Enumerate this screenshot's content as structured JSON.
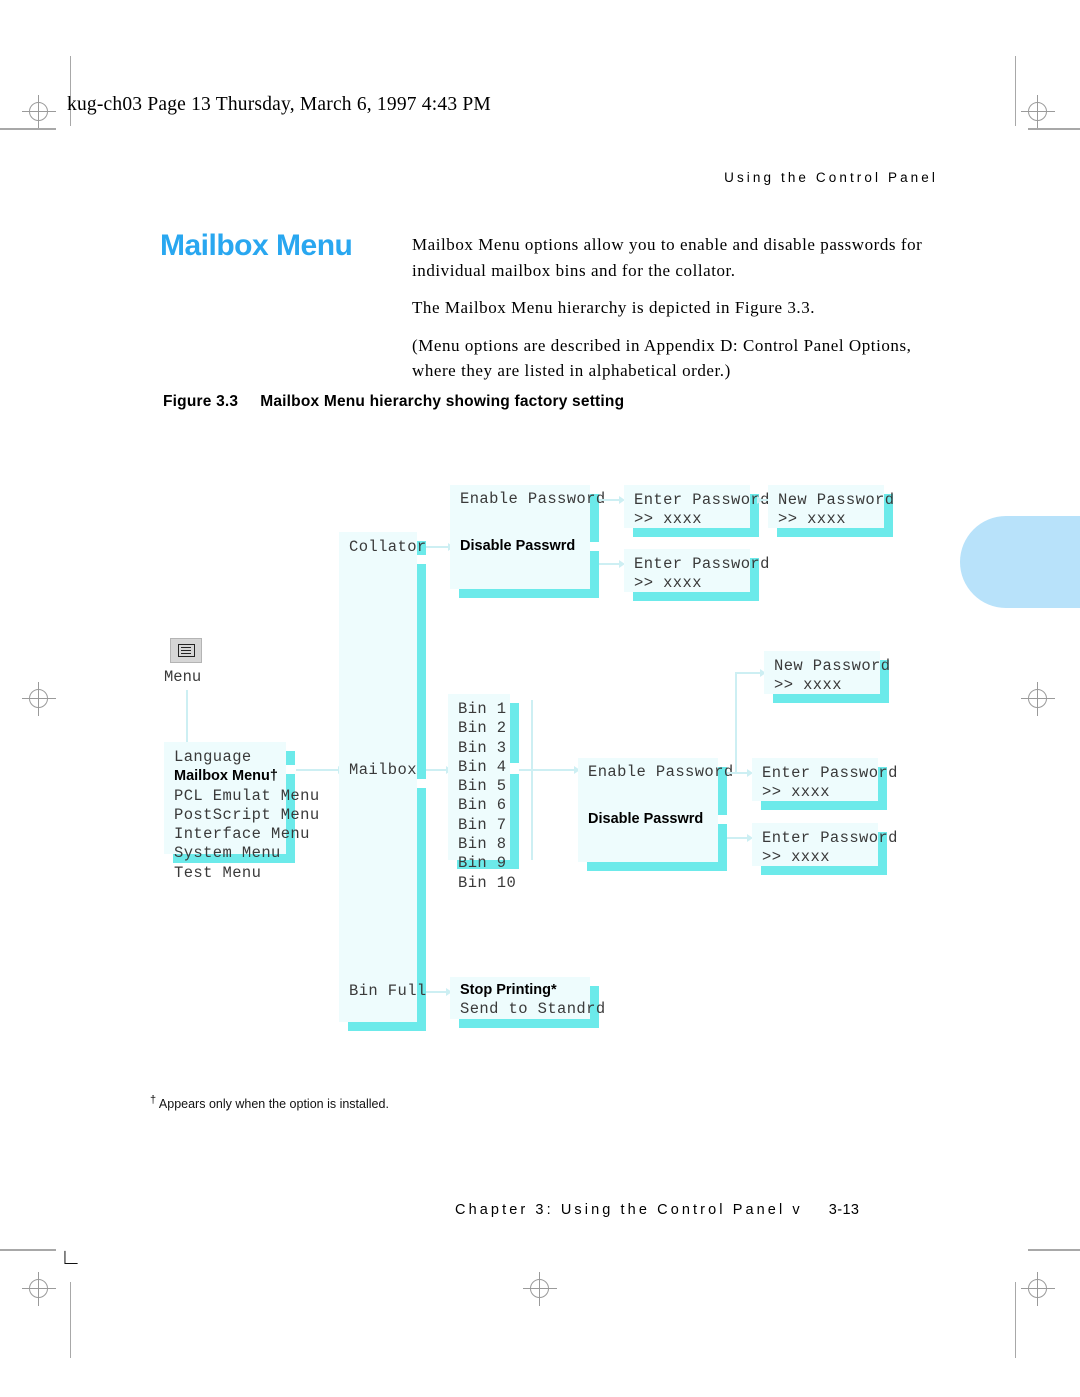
{
  "page": {
    "header_line": "kug-ch03  Page 13  Thursday, March 6, 1997  4:43 PM",
    "running_head": "Using the Control Panel",
    "footer_text": "Chapter 3: Using the Control Panel v",
    "footer_page": "3-13",
    "footnote_marker": "†",
    "footnote_text": " Appears only when the option is installed."
  },
  "title": {
    "heading": "Mailbox Menu",
    "paragraphs": [
      "Mailbox Menu options allow you to enable and disable passwords for individual mailbox bins and for the collator.",
      "The Mailbox Menu hierarchy is depicted in Figure 3.3.",
      "(Menu options are described in Appendix D: Control Panel Options, where they are listed in alphabetical order.)"
    ]
  },
  "figure": {
    "number": "Figure 3.3",
    "caption": "Mailbox Menu hierarchy showing factory setting"
  },
  "colors": {
    "heading_blue": "#29a7f0",
    "shadow_cyan": "#6ceaea",
    "panel_fill": "#eefcfd",
    "connector": "#cdeff3",
    "tab_blue": "#b8e2fa"
  },
  "diagram": {
    "menu_key": {
      "icon": "menu-list-icon",
      "label": "Menu"
    },
    "menu_list": {
      "items": [
        {
          "text": "Language",
          "bold": false
        },
        {
          "text": "Mailbox Menu†",
          "bold": true
        },
        {
          "text": "PCL Emulat Menu",
          "bold": false
        },
        {
          "text": "PostScript Menu",
          "bold": false
        },
        {
          "text": "Interface Menu",
          "bold": false
        },
        {
          "text": "System Menu",
          "bold": false
        },
        {
          "text": "Test Menu",
          "bold": false
        }
      ]
    },
    "mailbox_branch": {
      "items": [
        {
          "text": "Collator",
          "bold": false
        },
        {
          "text": "Mailbox",
          "bold": false
        },
        {
          "text": "Bin Full",
          "bold": false
        }
      ]
    },
    "collator_options": [
      {
        "text": "Enable Password",
        "bold": false
      },
      {
        "text": "Disable Passwrd",
        "bold": true
      }
    ],
    "collator_enable_enter": "Enter Password\n>> xxxx",
    "collator_enable_new": "New Password\n>> xxxx",
    "collator_disable_enter": "Enter Password\n>> xxxx",
    "bins": [
      "Bin 1",
      "Bin 2",
      "Bin 3",
      "Bin 4",
      "Bin 5",
      "Bin 6",
      "Bin 7",
      "Bin 8",
      "Bin 9",
      "Bin 10"
    ],
    "bin_new_password": "New Password\n>> xxxx",
    "bin_options": [
      {
        "text": "Enable Password",
        "bold": false
      },
      {
        "text": "Disable Passwrd",
        "bold": true
      }
    ],
    "bin_enable_enter": "Enter Password\n>> xxxx",
    "bin_disable_enter": "Enter Password\n>> xxxx",
    "bin_full_options": [
      {
        "text": "Stop Printing*",
        "bold": true
      },
      {
        "text": "Send to Standrd",
        "bold": false
      }
    ]
  }
}
